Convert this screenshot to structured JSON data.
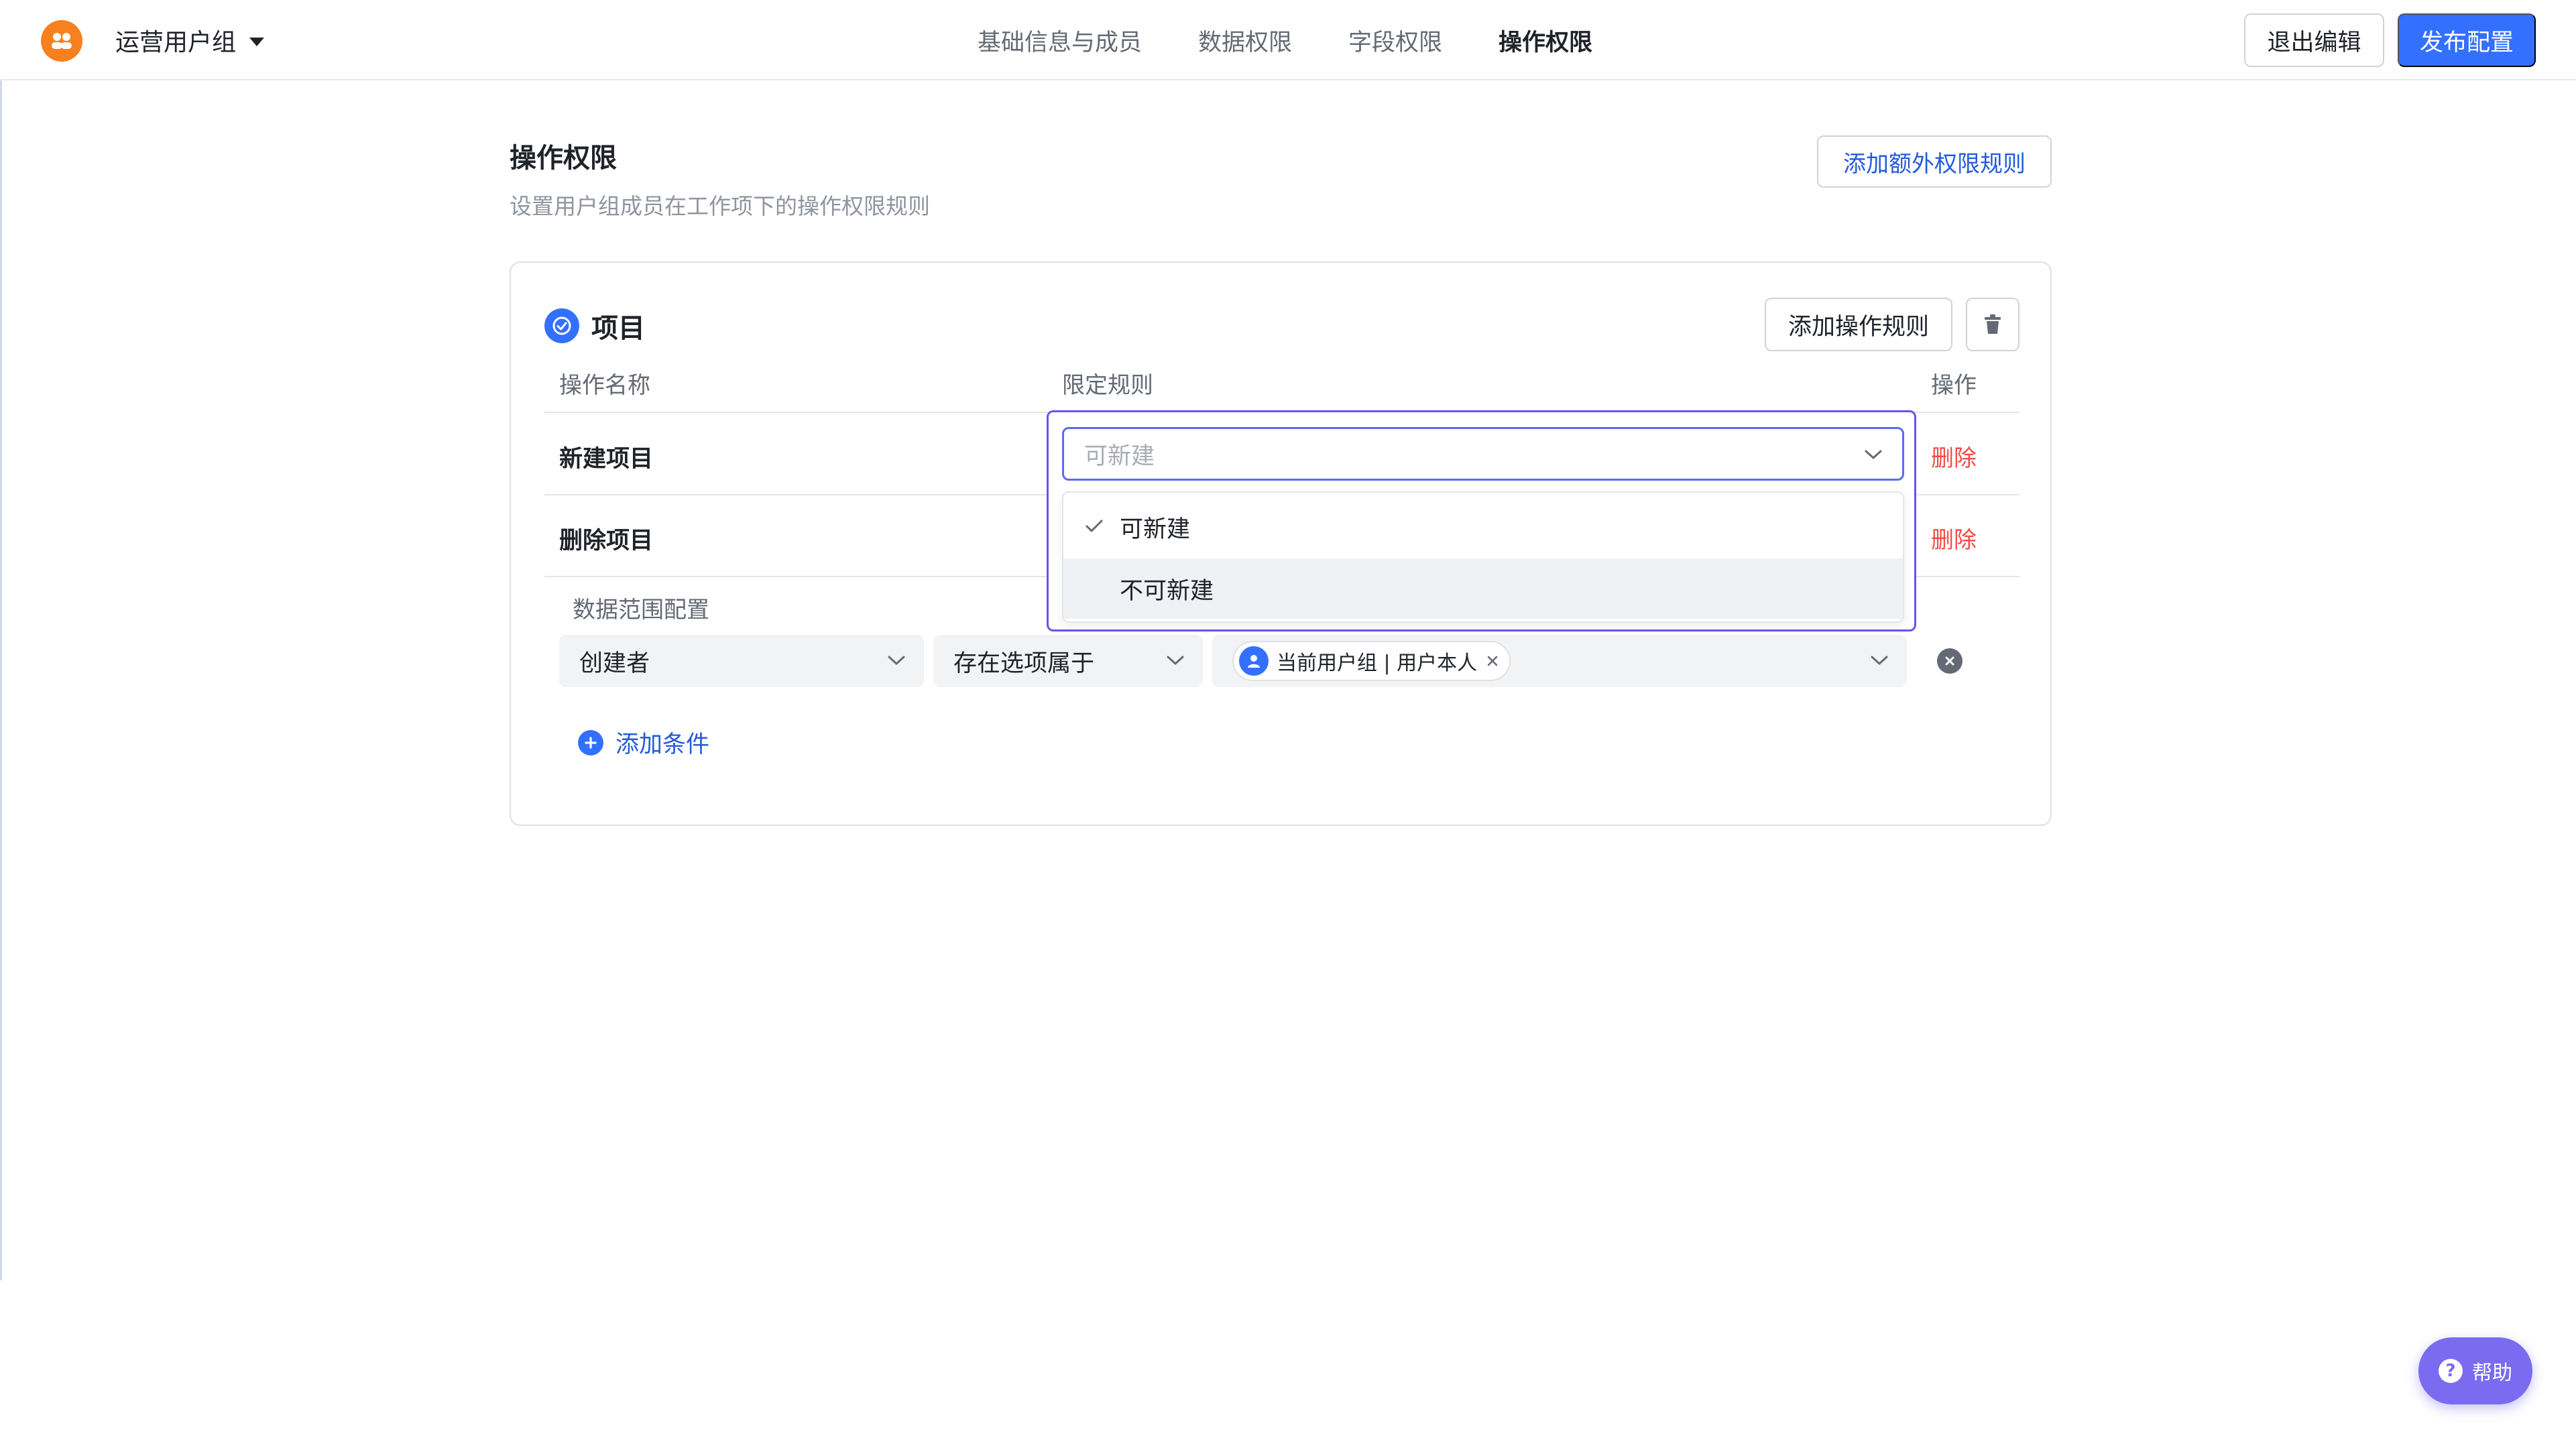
{
  "header": {
    "group_name": "运营用户组",
    "tabs": [
      {
        "label": "基础信息与成员",
        "active": false
      },
      {
        "label": "数据权限",
        "active": false
      },
      {
        "label": "字段权限",
        "active": false
      },
      {
        "label": "操作权限",
        "active": true
      }
    ],
    "exit_label": "退出编辑",
    "publish_label": "发布配置"
  },
  "section": {
    "title": "操作权限",
    "description": "设置用户组成员在工作项下的操作权限规则",
    "add_extra_label": "添加额外权限规则"
  },
  "card": {
    "title": "项目",
    "add_rule_label": "添加操作规则",
    "columns": {
      "name": "操作名称",
      "rule": "限定规则",
      "action": "操作"
    },
    "rows": [
      {
        "name": "新建项目",
        "action": "删除"
      },
      {
        "name": "删除项目",
        "action": "删除"
      }
    ],
    "scope": {
      "label": "数据范围配置",
      "field": "创建者",
      "operator": "存在选项属于",
      "value_chip": "当前用户组 | 用户本人",
      "add_condition_label": "添加条件"
    }
  },
  "dropdown": {
    "placeholder": "可新建",
    "options": [
      {
        "label": "可新建",
        "selected": true
      },
      {
        "label": "不可新建",
        "selected": false
      }
    ]
  },
  "help": {
    "label": "帮助"
  },
  "colors": {
    "primary": "#3370ff",
    "danger": "#f54a45",
    "logo": "#f7801f",
    "focus": "#6b52e8",
    "help": "#7a6bf0"
  }
}
